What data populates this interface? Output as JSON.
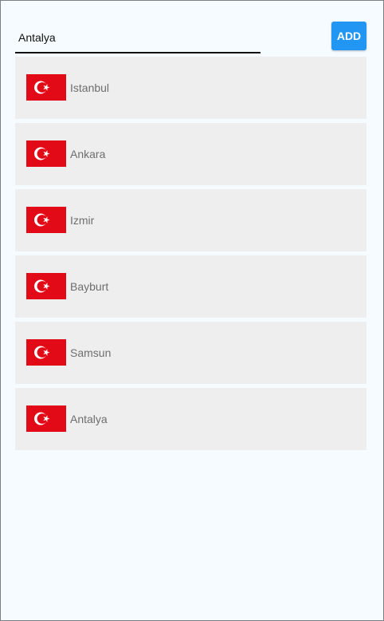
{
  "search": {
    "value": "Antalya",
    "placeholder": ""
  },
  "toolbar": {
    "add_label": "ADD"
  },
  "cities": [
    {
      "name": "Istanbul",
      "flag": "turkey-flag-icon"
    },
    {
      "name": "Ankara",
      "flag": "turkey-flag-icon"
    },
    {
      "name": "Izmir",
      "flag": "turkey-flag-icon"
    },
    {
      "name": "Bayburt",
      "flag": "turkey-flag-icon"
    },
    {
      "name": "Samsun",
      "flag": "turkey-flag-icon"
    },
    {
      "name": "Antalya",
      "flag": "turkey-flag-icon"
    }
  ],
  "colors": {
    "background": "#F5FBFF",
    "card": "#EEEEEE",
    "accent": "#2196F3",
    "flag_red": "#E30A17",
    "city_text": "#6E6E6E"
  }
}
